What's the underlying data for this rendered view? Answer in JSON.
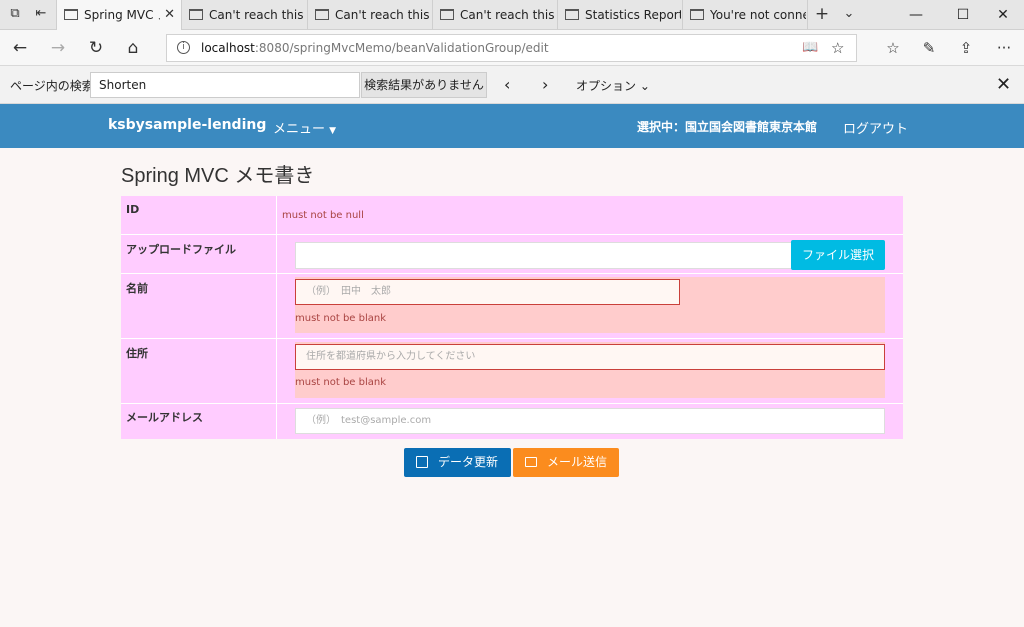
{
  "browser": {
    "tabs": [
      {
        "title": "Spring MVC メ"
      },
      {
        "title": "Can't reach this pa"
      },
      {
        "title": "Can't reach this pa"
      },
      {
        "title": "Can't reach this pa"
      },
      {
        "title": "Statistics Report fo"
      },
      {
        "title": "You're not connec"
      }
    ],
    "url_host": "localhost",
    "url_rest": ":8080/springMvcMemo/beanValidationGroup/edit",
    "find": {
      "label": "ページ内の検索",
      "value": "Shorten",
      "result": "検索結果がありません",
      "options": "オプション"
    }
  },
  "app": {
    "brand": "ksbysample-lending",
    "menu": "メニュー",
    "selected": "選択中：国立国会図書館東京本館",
    "logout": "ログアウト"
  },
  "page": {
    "title": "Spring MVC メモ書き",
    "fields": {
      "id_label": "ID",
      "id_error": "must not be null",
      "upload_label": "アップロードファイル",
      "upload_button": "ファイル選択",
      "name_label": "名前",
      "name_placeholder": "（例）　田中　太郎",
      "name_error": "must not be blank",
      "address_label": "住所",
      "address_placeholder": "住所を都道府県から入力してください",
      "address_error": "must not be blank",
      "email_label": "メールアドレス",
      "email_placeholder": "（例）　test@sample.com"
    },
    "buttons": {
      "update": "データ更新",
      "mail": "メール送信"
    }
  },
  "colors": {
    "navbar": "#3b8ac0",
    "form_bg": "#ffccff",
    "error_bg": "#ffcccc",
    "update_btn": "#0a6eb4",
    "mail_btn": "#fb8c1e",
    "file_btn": "#00bbe3"
  }
}
